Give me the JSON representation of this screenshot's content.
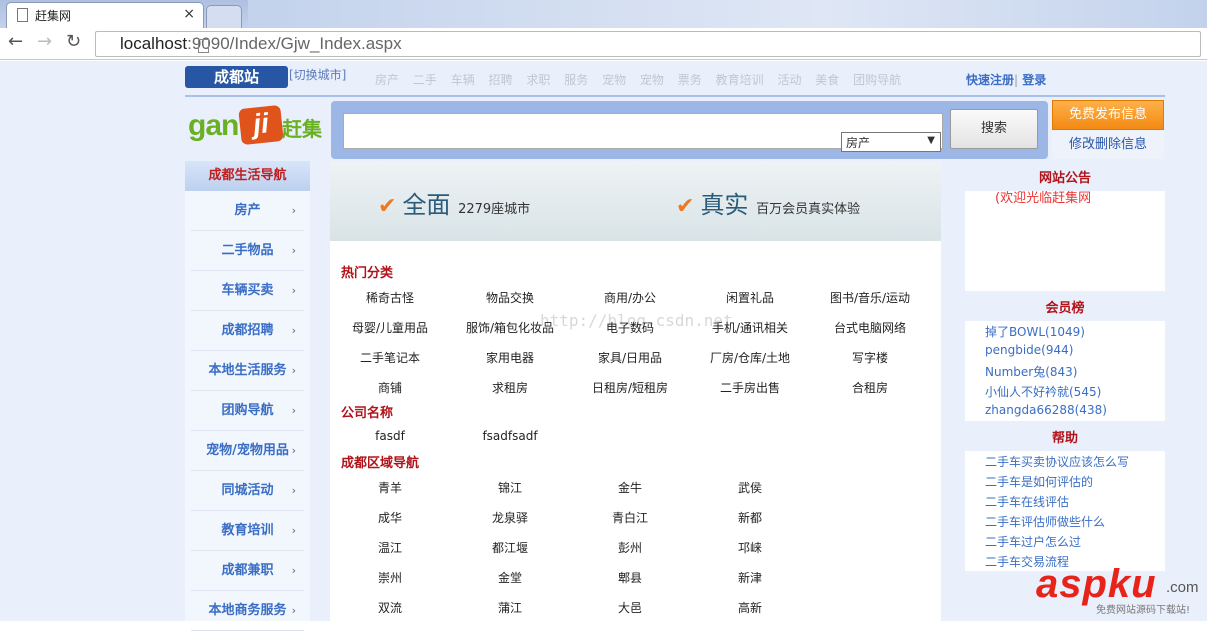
{
  "browser": {
    "tab_title": "赶集网",
    "tab_close": "×",
    "url_host": "localhost",
    "url_path": ":9090/Index/Gjw_Index.aspx"
  },
  "topnav": {
    "city": "成都站",
    "switch_city": "[切换城市]",
    "links": [
      "房产",
      "二手",
      "车辆",
      "招聘",
      "求职",
      "服务",
      "宠物",
      "宠物",
      "票务",
      "教育培训",
      "活动",
      "美食",
      "团购导航"
    ],
    "register": "快速注册",
    "divider": "|",
    "login": "登录"
  },
  "logo": {
    "gan": "gan",
    "ji": "ji",
    "cn": "赶集"
  },
  "search": {
    "category": "房产",
    "button": "搜索"
  },
  "actions": {
    "post": "免费发布信息",
    "edit": "修改删除信息"
  },
  "sidebar": {
    "title": "成都生活导航",
    "items": [
      "房产",
      "二手物品",
      "车辆买卖",
      "成都招聘",
      "本地生活服务",
      "团购导航",
      "宠物/宠物用品",
      "同城活动",
      "教育培训",
      "成都兼职",
      "本地商务服务"
    ]
  },
  "banner": {
    "item1_big": "全面",
    "item1_num": "2279",
    "item1_small": "座城市",
    "item2_big": "真实",
    "item2_small": "百万会员真实体验"
  },
  "watermark": "http://blog.csdn.net",
  "hot": {
    "title": "热门分类",
    "rows": [
      [
        "稀奇古怪",
        "物品交换",
        "商用/办公",
        "闲置礼品",
        "图书/音乐/运动"
      ],
      [
        "母婴/儿童用品",
        "服饰/箱包化妆品",
        "电子数码",
        "手机/通讯相关",
        "台式电脑网络"
      ],
      [
        "二手笔记本",
        "家用电器",
        "家具/日用品",
        "厂房/仓库/土地",
        "写字楼"
      ],
      [
        "商铺",
        "求租房",
        "日租房/短租房",
        "二手房出售",
        "合租房"
      ]
    ]
  },
  "company": {
    "title": "公司名称",
    "items": [
      "fasdf",
      "fsadfsadf"
    ]
  },
  "region": {
    "title": "成都区域导航",
    "rows": [
      [
        "青羊",
        "锦江",
        "金牛",
        "武侯"
      ],
      [
        "成华",
        "龙泉驿",
        "青白江",
        "新都"
      ],
      [
        "温江",
        "都江堰",
        "彭州",
        "邛崃"
      ],
      [
        "崇州",
        "金堂",
        "郫县",
        "新津"
      ],
      [
        "双流",
        "蒲江",
        "大邑",
        "高新"
      ]
    ]
  },
  "right": {
    "notice_title": "网站公告",
    "notice_scroll": "(欢迎光临赶集网",
    "members_title": "会员榜",
    "members": [
      "掉了BOWL(1049)",
      "pengbide(944)",
      "Number兔(843)",
      "小仙人不好衿就(545)",
      "zhangda66288(438)"
    ],
    "help_title": "帮助",
    "help": [
      "二手车买卖协议应该怎么写",
      "二手车是如何评估的",
      "二手车在线评估",
      "二手车评估师做些什么",
      "二手车过户怎么过",
      "二手车交易流程"
    ]
  },
  "site_watermark": {
    "main": "aspku",
    "com": ".com",
    "sub": "免费网站源码下载站!"
  },
  "colors": {
    "accent_blue": "#2656a4",
    "title_red": "#b0141a",
    "link_blue": "#3a6ec5",
    "orange": "#f28a12"
  }
}
